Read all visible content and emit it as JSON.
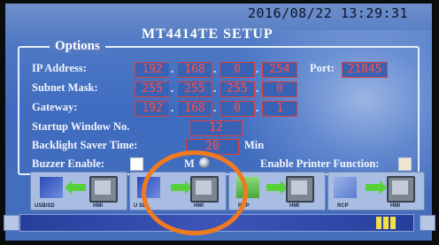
{
  "status": {
    "datetime": "2016/08/22  13:29:31"
  },
  "header": {
    "title": "MT4414TE   SETUP"
  },
  "options": {
    "legend": "Options",
    "ip_label": "IP Address:",
    "ip": [
      "192",
      "168",
      "0",
      "254"
    ],
    "port_label": "Port:",
    "port": "21845",
    "subnet_label": "Subnet Mask:",
    "subnet": [
      "255",
      "255",
      "255",
      "0"
    ],
    "gateway_label": "Gateway:",
    "gateway": [
      "192",
      "168",
      "0",
      "1"
    ],
    "startup_label": "Startup Window No.",
    "startup_value": "12",
    "backlight_label": "Backlight Saver Time:",
    "backlight_value": "20",
    "backlight_unit": "Min",
    "buzzer_label": "Buzzer Enable:",
    "mouse_label": "M",
    "printer_label": "Enable Printer Function:"
  },
  "modes": [
    {
      "source": "USB/SD",
      "target": "HMI"
    },
    {
      "source": "U   SD",
      "target": "HMI"
    },
    {
      "source": "RCP",
      "target": "HMI"
    },
    {
      "source": "RCP",
      "target": "HMI"
    }
  ],
  "colors": {
    "annotation": "#f07a1f",
    "field_text": "#ff4e48",
    "arrow": "#57d13a"
  }
}
